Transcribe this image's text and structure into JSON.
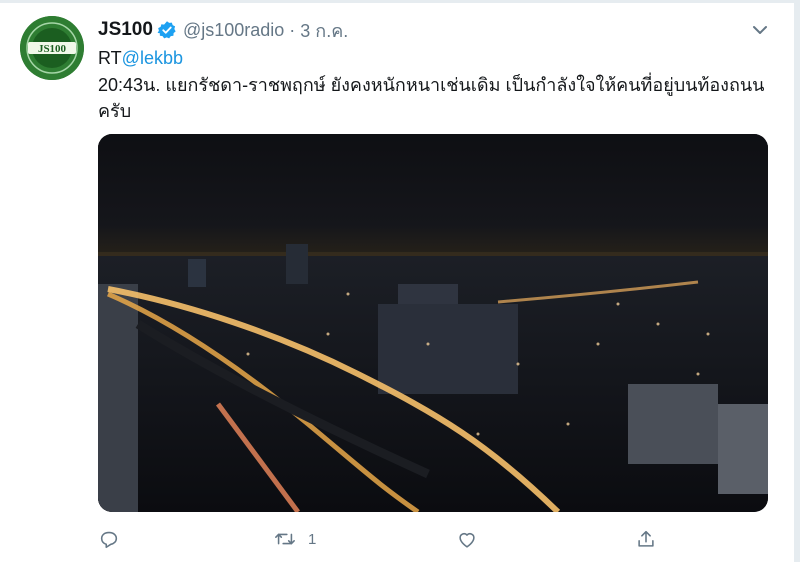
{
  "tweet": {
    "display_name": "JS100",
    "verified": true,
    "handle": "@js100radio",
    "separator": "·",
    "timestamp": "3 ก.ค.",
    "rt_prefix": "RT",
    "rt_mention": "@lekbb",
    "text": "20:43น. แยกรัชดา-ราชพฤกษ์ ยังคงหนักหนาเช่นเดิม เป็นกำลังใจให้คนที่อยู่บนท้องถนนครับ",
    "avatar_logo_text": "JS100",
    "media_description": "night aerial photo of city highway interchange"
  },
  "actions": {
    "reply_icon": "reply-icon",
    "retweet_icon": "retweet-icon",
    "retweet_count": "1",
    "like_icon": "heart-icon",
    "share_icon": "share-icon"
  },
  "colors": {
    "link": "#1b95e0",
    "secondary_text": "#657786",
    "avatar_green": "#2e7d32",
    "verified_blue": "#1da1f2"
  }
}
